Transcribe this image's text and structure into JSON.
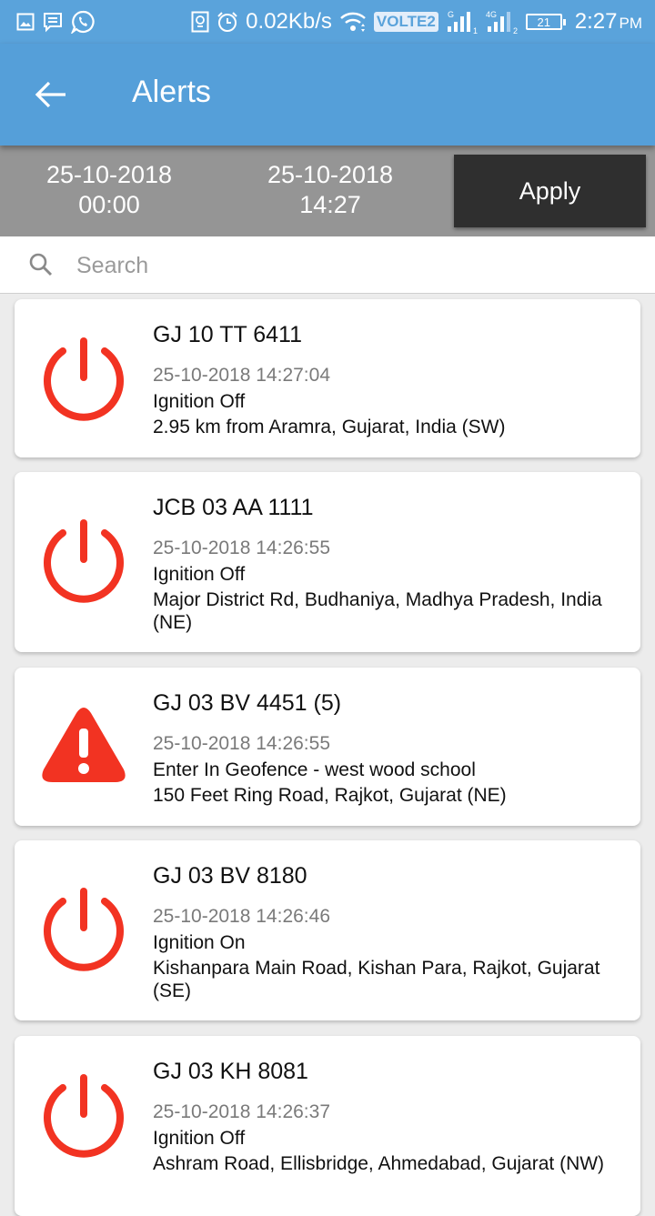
{
  "status_bar": {
    "left_icons": [
      "gallery-icon",
      "message-icon",
      "whatsapp-icon"
    ],
    "right_icons": [
      "sim-icon",
      "alarm-icon"
    ],
    "network_speed": "0.02Kb/s",
    "volte_label": "VOLTE2",
    "signal1_label": "G",
    "signal1_index": "1",
    "signal2_label": "4G",
    "signal2_index": "2",
    "battery_level": "21",
    "time": "2:27",
    "ampm": "PM"
  },
  "app_bar": {
    "title": "Alerts",
    "back_icon": "arrow-left-icon"
  },
  "filter": {
    "from_date": "25-10-2018",
    "from_time": "00:00",
    "to_date": "25-10-2018",
    "to_time": "14:27",
    "apply_label": "Apply"
  },
  "search": {
    "placeholder": "Search",
    "value": ""
  },
  "colors": {
    "primary": "#559fd9",
    "status_bar": "#5aa3db",
    "filter_bar": "#959595",
    "apply_button": "#2f2f2f",
    "alert_red": "#f23322"
  },
  "alerts": [
    {
      "icon": "power-icon",
      "vehicle": "GJ 10 TT 6411",
      "timestamp": "25-10-2018 14:27:04",
      "event": "Ignition Off",
      "address": "2.95 km from Aramra, Gujarat, India (SW)"
    },
    {
      "icon": "power-icon",
      "vehicle": "JCB 03 AA 1111",
      "timestamp": "25-10-2018 14:26:55",
      "event": "Ignition Off",
      "address": "Major District Rd, Budhaniya, Madhya Pradesh,  India (NE)"
    },
    {
      "icon": "warning-icon",
      "vehicle": "GJ 03 BV 4451 (5)",
      "timestamp": "25-10-2018 14:26:55",
      "event": "Enter In Geofence - west wood school",
      "address": "150 Feet Ring Road, Rajkot, Gujarat (NE)"
    },
    {
      "icon": "power-icon",
      "vehicle": "GJ 03 BV 8180",
      "timestamp": "25-10-2018 14:26:46",
      "event": "Ignition On",
      "address": "Kishanpara Main Road, Kishan Para, Rajkot, Gujarat (SE)"
    },
    {
      "icon": "power-icon",
      "vehicle": "GJ 03 KH 8081",
      "timestamp": "25-10-2018 14:26:37",
      "event": "Ignition Off",
      "address": "Ashram Road, Ellisbridge, Ahmedabad, Gujarat (NW)"
    }
  ]
}
